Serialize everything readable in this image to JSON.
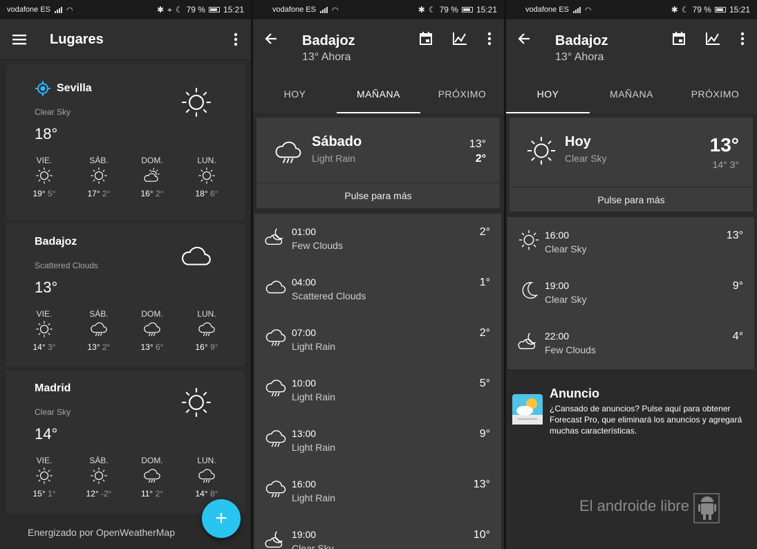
{
  "status": {
    "carrier": "vodafone ES",
    "battery": "79 %",
    "time": "15:21"
  },
  "panel1": {
    "title": "Lugares",
    "places": [
      {
        "name": "Sevilla",
        "condition": "Clear Sky",
        "temp": "18°",
        "icon": "sun-icon",
        "days": [
          {
            "day": "VIE.",
            "hi": "19°",
            "lo": "5°",
            "icon": "sun-icon"
          },
          {
            "day": "SÁB.",
            "hi": "17°",
            "lo": "2°",
            "icon": "sun-icon"
          },
          {
            "day": "DOM.",
            "hi": "16°",
            "lo": "2°",
            "icon": "partly-cloudy-icon"
          },
          {
            "day": "LUN.",
            "hi": "18°",
            "lo": "6°",
            "icon": "sun-icon"
          }
        ]
      },
      {
        "name": "Badajoz",
        "condition": "Scattered Clouds",
        "temp": "13°",
        "icon": "cloud-icon",
        "days": [
          {
            "day": "VIE.",
            "hi": "14°",
            "lo": "3°",
            "icon": "sun-icon"
          },
          {
            "day": "SÁB.",
            "hi": "13°",
            "lo": "2°",
            "icon": "rain-cloud-icon"
          },
          {
            "day": "DOM.",
            "hi": "13°",
            "lo": "6°",
            "icon": "rain-cloud-icon"
          },
          {
            "day": "LUN.",
            "hi": "16°",
            "lo": "9°",
            "icon": "rain-cloud-icon"
          }
        ]
      },
      {
        "name": "Madrid",
        "condition": "Clear Sky",
        "temp": "14°",
        "icon": "sun-icon",
        "days": [
          {
            "day": "VIE.",
            "hi": "15°",
            "lo": "1°",
            "icon": "sun-icon"
          },
          {
            "day": "SÁB.",
            "hi": "12°",
            "lo": "-2°",
            "icon": "sun-icon"
          },
          {
            "day": "DOM.",
            "hi": "11°",
            "lo": "2°",
            "icon": "rain-cloud-icon"
          },
          {
            "day": "LUN.",
            "hi": "14°",
            "lo": "8°",
            "icon": "rain-cloud-icon"
          }
        ]
      }
    ],
    "footer": "Energizado por OpenWeatherMap",
    "fab": "+"
  },
  "panel2": {
    "city": "Badajoz",
    "subtitle": "13° Ahora",
    "tabs": [
      "HOY",
      "MAÑANA",
      "PRÓXIMO"
    ],
    "active_tab": "MAÑANA",
    "summary": {
      "day": "Sábado",
      "condition": "Light Rain",
      "hi": "13°",
      "lo": "2°",
      "more": "Pulse para más"
    },
    "hours": [
      {
        "time": "01:00",
        "condition": "Few Clouds",
        "temp": "2°",
        "icon": "moon-cloud-icon"
      },
      {
        "time": "04:00",
        "condition": "Scattered Clouds",
        "temp": "1°",
        "icon": "cloud-icon"
      },
      {
        "time": "07:00",
        "condition": "Light Rain",
        "temp": "2°",
        "icon": "rain-cloud-icon"
      },
      {
        "time": "10:00",
        "condition": "Light Rain",
        "temp": "5°",
        "icon": "rain-cloud-icon"
      },
      {
        "time": "13:00",
        "condition": "Light Rain",
        "temp": "9°",
        "icon": "rain-cloud-icon"
      },
      {
        "time": "16:00",
        "condition": "Light Rain",
        "temp": "13°",
        "icon": "rain-cloud-icon"
      },
      {
        "time": "19:00",
        "condition": "Clear Sky",
        "temp": "10°",
        "icon": "moon-cloud-icon"
      }
    ]
  },
  "panel3": {
    "city": "Badajoz",
    "subtitle": "13° Ahora",
    "tabs": [
      "HOY",
      "MAÑANA",
      "PRÓXIMO"
    ],
    "active_tab": "HOY",
    "summary": {
      "day": "Hoy",
      "condition": "Clear Sky",
      "temp": "13°",
      "hilo": "14° 3°",
      "more": "Pulse para más"
    },
    "hours": [
      {
        "time": "16:00",
        "condition": "Clear Sky",
        "temp": "13°",
        "icon": "sun-icon"
      },
      {
        "time": "19:00",
        "condition": "Clear Sky",
        "temp": "9°",
        "icon": "moon-icon"
      },
      {
        "time": "22:00",
        "condition": "Few Clouds",
        "temp": "4°",
        "icon": "moon-cloud-icon"
      }
    ],
    "ad": {
      "title": "Anuncio",
      "text": "¿Cansado de anuncios? Pulse aquí para obtener Forecast Pro, que eliminará los anuncios y agregará muchas características."
    },
    "watermark": "El androide libre"
  }
}
